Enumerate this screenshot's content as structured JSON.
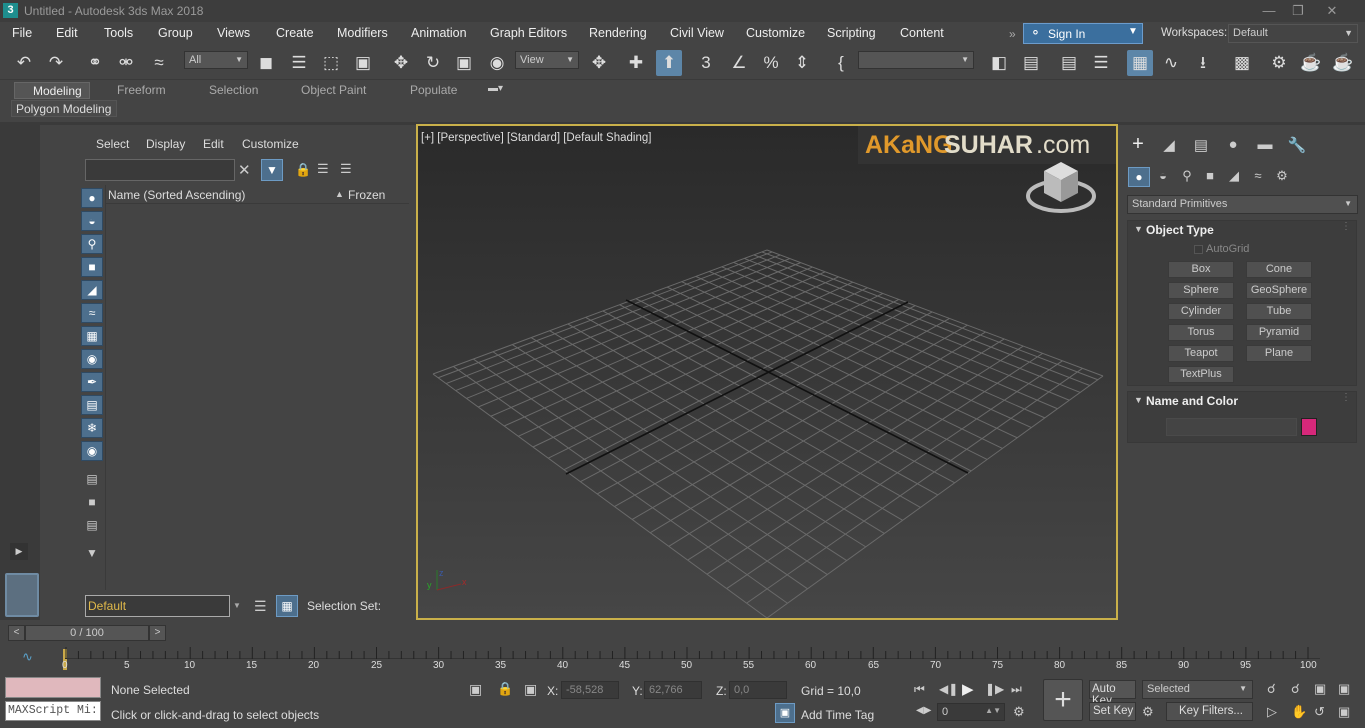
{
  "title": "Untitled - Autodesk 3ds Max 2018",
  "menu": [
    "File",
    "Edit",
    "Tools",
    "Group",
    "Views",
    "Create",
    "Modifiers",
    "Animation",
    "Graph Editors",
    "Rendering",
    "Civil View",
    "Customize",
    "Scripting",
    "Content"
  ],
  "sign_in": "Sign In",
  "workspaces_label": "Workspaces:",
  "workspaces_value": "Default",
  "toolbar": {
    "filter_value": "All",
    "ref_coord_value": "View"
  },
  "ribbon": {
    "tabs": [
      "Modeling",
      "Freeform",
      "Selection",
      "Object Paint",
      "Populate"
    ],
    "active_tab": "Modeling",
    "subtab": "Polygon Modeling"
  },
  "scene_explorer": {
    "menu": [
      "Select",
      "Display",
      "Edit",
      "Customize"
    ],
    "col_name": "Name (Sorted Ascending)",
    "col_frozen": "Frozen",
    "layer_value": "Default",
    "selection_set_label": "Selection Set:"
  },
  "viewport": {
    "label": "[+] [Perspective] [Standard] [Default Shading]",
    "watermark_a": "AKaNG",
    "watermark_b": "SUHAR",
    "watermark_c": ".com"
  },
  "command_panel": {
    "category": "Standard Primitives",
    "object_type_title": "Object Type",
    "autogrid": "AutoGrid",
    "buttons": [
      "Box",
      "Cone",
      "Sphere",
      "GeoSphere",
      "Cylinder",
      "Tube",
      "Torus",
      "Pyramid",
      "Teapot",
      "Plane",
      "TextPlus"
    ],
    "name_color_title": "Name and Color",
    "object_color": "#d6287a"
  },
  "time_slider": {
    "frame": "0 / 100"
  },
  "trackbar_ticks": [
    "0",
    "5",
    "10",
    "15",
    "20",
    "25",
    "30",
    "35",
    "40",
    "45",
    "50",
    "55",
    "60",
    "65",
    "70",
    "75",
    "80",
    "85",
    "90",
    "95",
    "100"
  ],
  "status": {
    "maxscript": "MAXScript Mi:",
    "none_selected": "None Selected",
    "prompt": "Click or click-and-drag to select objects",
    "x_label": "X:",
    "x_value": "-58,528",
    "y_label": "Y:",
    "y_value": "62,766",
    "z_label": "Z:",
    "z_value": "0,0",
    "grid": "Grid = 10,0",
    "add_time_tag": "Add Time Tag",
    "auto_key": "Auto Key",
    "set_key": "Set Key",
    "key_mode_value": "Selected",
    "key_filters": "Key Filters...",
    "current_frame": "0"
  }
}
